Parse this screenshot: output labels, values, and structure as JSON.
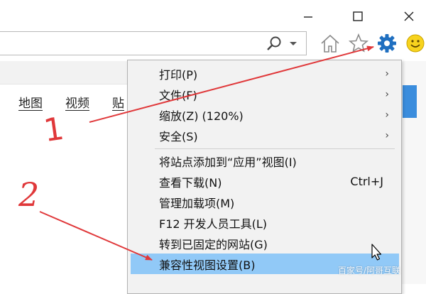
{
  "window": {
    "minimize_icon": "minimize-icon",
    "maximize_icon": "maximize-icon",
    "close_icon": "close-icon"
  },
  "toolbar": {
    "search_icon": "search-icon",
    "dropdown_icon": "chevron-down-icon",
    "home_icon": "home-icon",
    "favorites_icon": "star-icon",
    "tools_icon": "gear-icon",
    "feedback_icon": "smiley-icon"
  },
  "page": {
    "links": [
      "地图",
      "视频",
      "贴"
    ]
  },
  "menu": {
    "items": [
      {
        "label": "打印(P)",
        "submenu": true
      },
      {
        "label": "文件(F)",
        "submenu": true
      },
      {
        "label": "缩放(Z) (120%)",
        "submenu": true
      },
      {
        "label": "安全(S)",
        "submenu": true
      },
      {
        "label": "将站点添加到“应用”视图(I)"
      },
      {
        "label": "查看下载(N)",
        "shortcut": "Ctrl+J"
      },
      {
        "label": "管理加载项(M)"
      },
      {
        "label": "F12 开发人员工具(L)"
      },
      {
        "label": "转到已固定的网站(G)"
      },
      {
        "label": "兼容性视图设置(B)",
        "highlighted": true
      }
    ],
    "arrow_glyph": "›"
  },
  "annotations": {
    "step1": "1",
    "step2": "2",
    "arrow_color": "#e0383a"
  },
  "watermark": "百家号/阿哥互联"
}
